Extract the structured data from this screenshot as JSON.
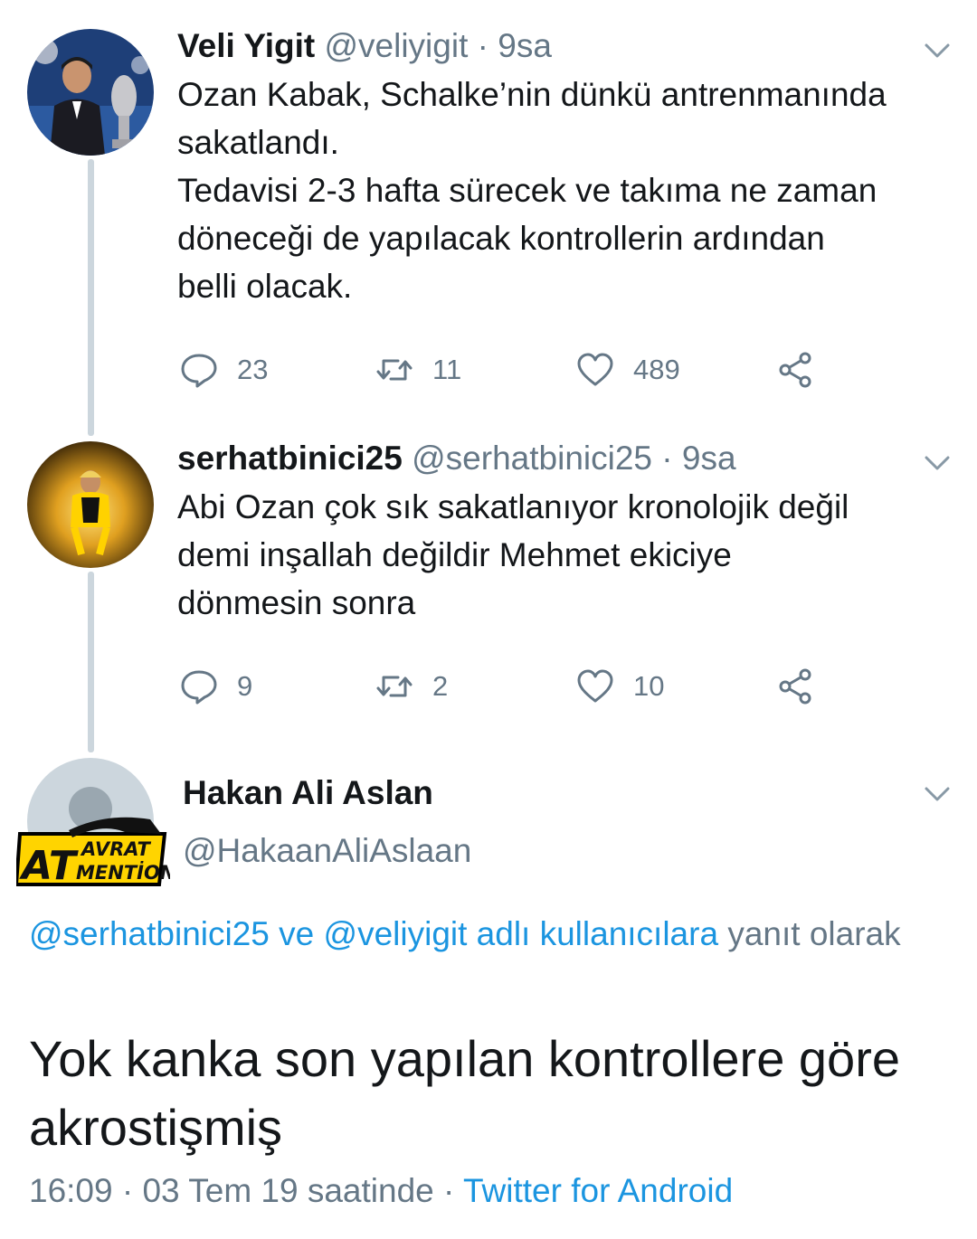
{
  "tweets": [
    {
      "name": "Veli Yigit",
      "handle": "@veliyigit",
      "time": "9sa",
      "text": "Ozan Kabak, Schalke’nin dünkü antrenmanında\nsakatlandı.\nTedavisi 2-3 hafta sürecek ve takıma ne zaman\ndöneceği de yapılacak kontrollerin ardından\nbelli olacak.",
      "replies": "23",
      "retweets": "11",
      "likes": "489"
    },
    {
      "name": "serhatbinici25",
      "handle": "@serhatbinici25",
      "time": "9sa",
      "text": "Abi Ozan çok sık sakatlanıyor kronolojik değil\ndemi inşallah değildir Mehmet ekiciye\ndönmesin sonra",
      "replies": "9",
      "retweets": "2",
      "likes": "10"
    }
  ],
  "main_tweet": {
    "name": "Hakan Ali Aslan",
    "handle": "@HakaanAliAslaan",
    "logo_text": {
      "line1": "AT",
      "line2": "AVRAT",
      "line3": "MENTİON"
    },
    "reply_mention_1": "@serhatbinici25",
    "reply_and": " ve ",
    "reply_mention_2": "@veliyigit adlı kullanıcılara",
    "reply_suffix": " yanıt olarak",
    "text": "Yok kanka son yapılan kontrollere göre\nakrostişmiş",
    "timestamp": "16:09 · 03 Tem 19 saatinde",
    "separator": " · ",
    "source": "Twitter for Android"
  },
  "colors": {
    "accent": "#1b95e0",
    "secondary_text": "#657786",
    "thread_line": "#ccd6dd"
  },
  "icons": [
    "reply-icon",
    "retweet-icon",
    "like-icon",
    "share-icon",
    "chevron-down-icon"
  ]
}
